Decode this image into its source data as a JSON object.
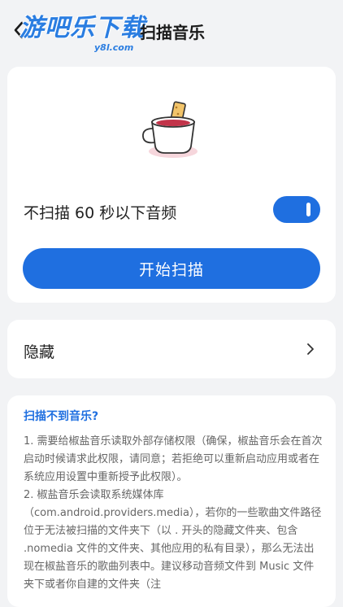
{
  "header": {
    "title": "扫描音乐",
    "watermark_main": "游吧乐下载",
    "watermark_sub": "y8l.com"
  },
  "main": {
    "skip_label": "不扫描 60 秒以下音频",
    "skip_toggle_on": true,
    "scan_button": "开始扫描"
  },
  "hidden": {
    "label": "隐藏"
  },
  "help": {
    "title": "扫描不到音乐?",
    "item1": "1. 需要给椒盐音乐读取外部存储权限（确保，椒盐音乐会在首次启动时候请求此权限，请同意；若拒绝可以重新启动应用或者在系统应用设置中重新授予此权限）。",
    "item2": "2. 椒盐音乐会读取系统媒体库（com.android.providers.media），若你的一些歌曲文件路径位于无法被扫描的文件夹下（以 . 开头的隐藏文件夹、包含 .nomedia 文件的文件夹、其他应用的私有目录），那么无法出现在椒盐音乐的歌曲列表中。建议移动音频文件到 Music 文件夹下或者你自建的文件夹（注"
  },
  "colors": {
    "accent": "#1f6fe0",
    "background": "#f2f3f5"
  }
}
